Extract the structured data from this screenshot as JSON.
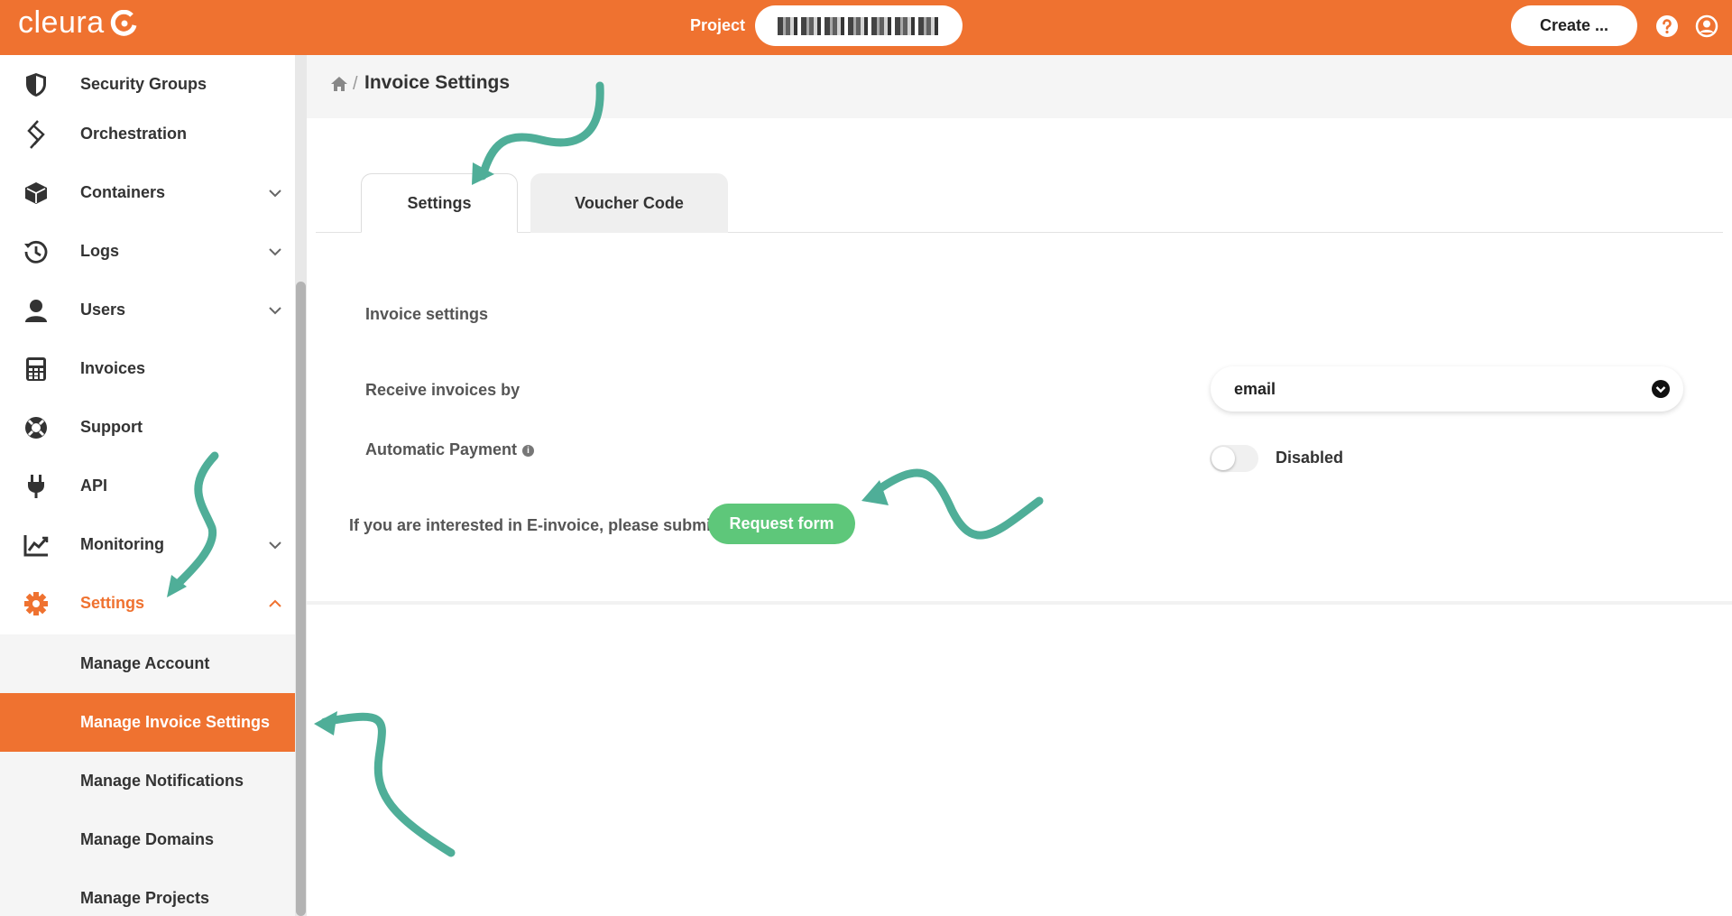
{
  "topbar": {
    "logo_text": "cleura",
    "project_label": "Project",
    "project_value_redacted": true,
    "create_label": "Create ...",
    "accent_color": "#ef7230"
  },
  "sidebar": {
    "items": [
      {
        "label": "Security Groups",
        "icon": "shield-icon",
        "expandable": false
      },
      {
        "label": "Orchestration",
        "icon": "orchestration-icon",
        "expandable": false
      },
      {
        "label": "Containers",
        "icon": "cube-icon",
        "expandable": true
      },
      {
        "label": "Logs",
        "icon": "history-icon",
        "expandable": true
      },
      {
        "label": "Users",
        "icon": "user-icon",
        "expandable": true
      },
      {
        "label": "Invoices",
        "icon": "calculator-icon",
        "expandable": false
      },
      {
        "label": "Support",
        "icon": "lifebuoy-icon",
        "expandable": false
      },
      {
        "label": "API",
        "icon": "plug-icon",
        "expandable": false
      },
      {
        "label": "Monitoring",
        "icon": "chart-icon",
        "expandable": true
      },
      {
        "label": "Settings",
        "icon": "gear-icon",
        "expandable": true,
        "expanded": true,
        "active": true
      }
    ],
    "settings_submenu": [
      {
        "label": "Manage Account"
      },
      {
        "label": "Manage Invoice Settings",
        "current": true
      },
      {
        "label": "Manage Notifications"
      },
      {
        "label": "Manage Domains"
      },
      {
        "label": "Manage Projects"
      }
    ]
  },
  "breadcrumb": {
    "separator": "/",
    "title": "Invoice Settings"
  },
  "tabs": [
    {
      "label": "Settings",
      "active": true
    },
    {
      "label": "Voucher Code",
      "active": false
    }
  ],
  "form": {
    "section_title": "Invoice settings",
    "receive_label": "Receive invoices by",
    "receive_value": "email",
    "autopay_label": "Automatic Payment",
    "autopay_info": "i",
    "autopay_state": "Disabled",
    "autopay_enabled": false,
    "einvoice_text": "If you are interested in E-invoice, please submit",
    "request_button": "Request form",
    "request_button_color": "#5ec77a"
  },
  "annotation_color": "#4fae98"
}
